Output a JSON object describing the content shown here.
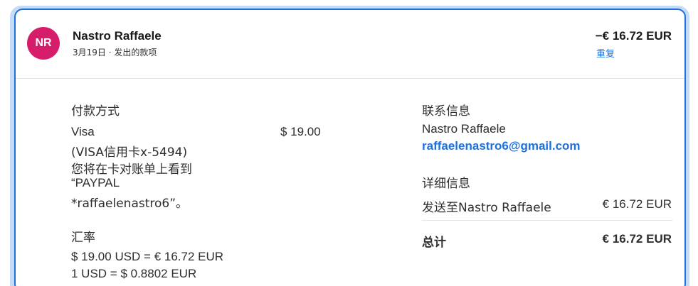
{
  "header": {
    "avatar_initials": "NR",
    "name": "Nastro Raffaele",
    "subline": "3月19日 · 发出的款项",
    "amount": "−€ 16.72 EUR",
    "repeat_label": "重复"
  },
  "payment": {
    "title": "付款方式",
    "method": "Visa",
    "card": "(VISA信用卡x-5494)",
    "statement_line1": "您将在卡对账单上看到",
    "statement_line2": "“PAYPAL",
    "statement_line3": "*raffaelenastro6”。",
    "amount": "$ 19.00"
  },
  "exchange": {
    "title": "汇率",
    "line1": "$ 19.00 USD = € 16.72 EUR",
    "line2": "1 USD = $ 0.8802 EUR"
  },
  "contact": {
    "title": "联系信息",
    "name": "Nastro Raffaele",
    "email": "raffaelenastro6@gmail.com"
  },
  "details": {
    "title": "详细信息",
    "sent_to": "发送至Nastro Raffaele",
    "sent_amount": "€ 16.72 EUR",
    "total_label": "总计",
    "total_amount": "€ 16.72 EUR"
  },
  "colors": {
    "accent": "#1f6fdc",
    "avatar": "#d61d6b",
    "outer_border": "#c5dcf7"
  }
}
